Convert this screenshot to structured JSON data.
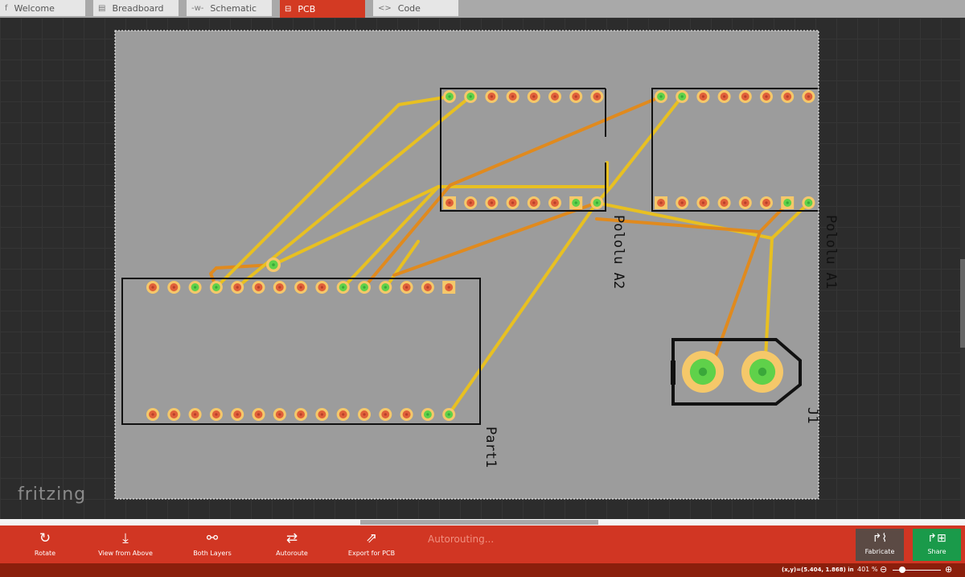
{
  "tabs": [
    {
      "label": "Welcome",
      "icon": "fritzing-f-icon",
      "glyph": "f"
    },
    {
      "label": "Breadboard",
      "icon": "breadboard-icon",
      "glyph": "▤"
    },
    {
      "label": "Schematic",
      "icon": "schematic-icon",
      "glyph": "-w-"
    },
    {
      "label": "PCB",
      "icon": "pcb-icon",
      "glyph": "⊟"
    },
    {
      "label": "Code",
      "icon": "code-icon",
      "glyph": "<>"
    }
  ],
  "active_tab": "PCB",
  "board": {
    "parts": {
      "part1": "Part1",
      "pololu_a2": "Pololu A2",
      "pololu_a1": "Pololu A1",
      "j1": "J1"
    }
  },
  "logo": "fritzing",
  "toolbar": {
    "rotate": "Rotate",
    "view_from_above": "View from Above",
    "both_layers": "Both Layers",
    "autoroute": "Autoroute",
    "export": "Export for PCB",
    "status": "Autorouting...",
    "fabricate": "Fabricate",
    "share": "Share"
  },
  "statusbar": {
    "coords": "(x,y)=(5.404, 1.868) in",
    "zoom": "401 %"
  },
  "colors": {
    "accent": "#d13623",
    "share": "#1a9a4a",
    "fabricate": "#5b4a44",
    "trace_top": "#e8c021",
    "trace_bottom": "#e08a1e"
  }
}
